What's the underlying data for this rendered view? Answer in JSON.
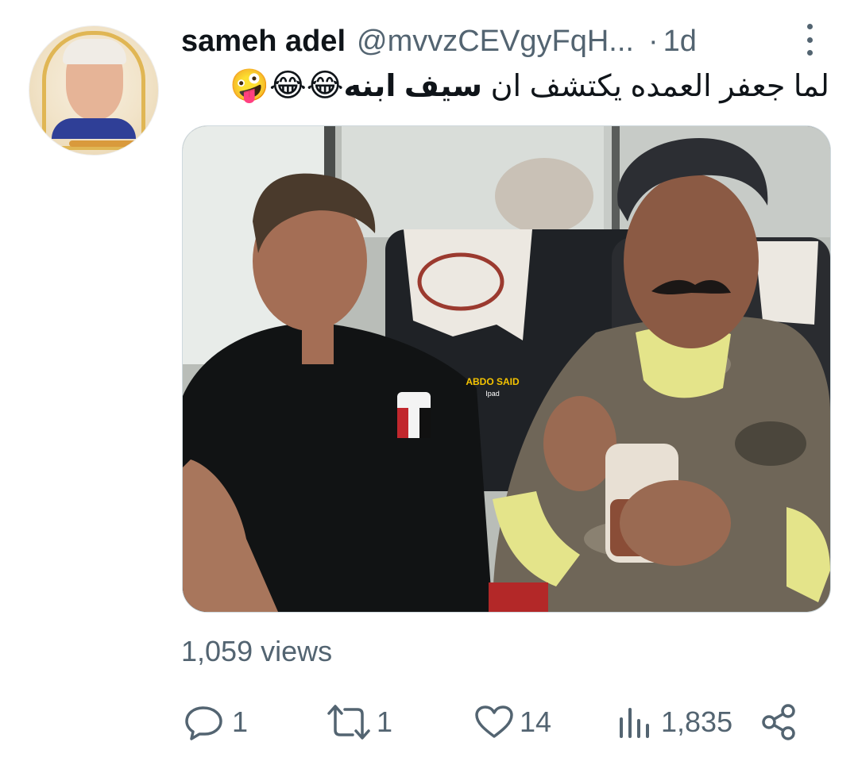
{
  "tweet": {
    "author_name": "sameh adel",
    "author_handle": "@mvvzCEVgyFqH...",
    "separator": "·",
    "time": "1d",
    "text_before": "لما جعفر العمده يكتشف ان ",
    "text_bold": "سيف ابنه",
    "emojis": "😂😂🤪",
    "media_watermark_line1": "ABDO SAID",
    "media_watermark_line2": "Ipad",
    "views_label": "1,059 views"
  },
  "actions": {
    "reply_count": "1",
    "retweet_count": "1",
    "like_count": "14",
    "analytics_count": "1,835"
  },
  "icons": {
    "more": "more-vertical-icon",
    "reply": "reply-bubble-icon",
    "retweet": "retweet-icon",
    "like": "heart-icon",
    "analytics": "bar-chart-icon",
    "share": "share-icon",
    "mute": "muted-speaker-icon"
  },
  "colors": {
    "text_primary": "#0f1419",
    "text_secondary": "#536471",
    "border": "#cfd9de"
  }
}
